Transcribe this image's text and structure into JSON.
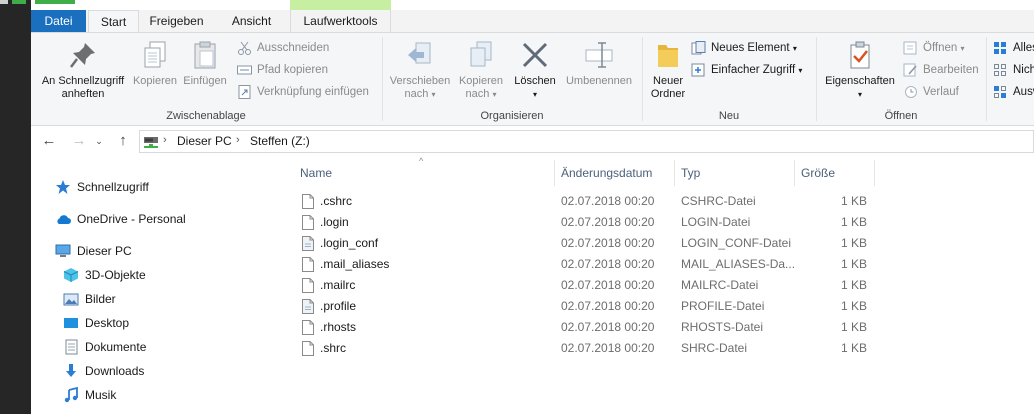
{
  "ribbon_tabs": {
    "file": "Datei",
    "start": "Start",
    "share": "Freigeben",
    "view": "Ansicht",
    "drive_tools": "Laufwerktools"
  },
  "clipboard": {
    "group_label": "Zwischenablage",
    "pin": "An Schnellzugriff anheften",
    "copy": "Kopieren",
    "paste": "Einfügen",
    "cut": "Ausschneiden",
    "copy_path": "Pfad kopieren",
    "paste_shortcut": "Verknüpfung einfügen"
  },
  "organize": {
    "group_label": "Organisieren",
    "move_to_1": "Verschieben",
    "move_to_2": "nach",
    "copy_to_1": "Kopieren",
    "copy_to_2": "nach",
    "delete": "Löschen",
    "rename": "Umbenennen"
  },
  "new": {
    "group_label": "Neu",
    "new_folder_1": "Neuer",
    "new_folder_2": "Ordner",
    "new_item": "Neues Element",
    "easy_access": "Einfacher Zugriff"
  },
  "open": {
    "group_label": "Öffnen",
    "properties": "Eigenschaften",
    "open": "Öffnen",
    "edit": "Bearbeiten",
    "history": "Verlauf"
  },
  "select": {
    "select_all": "Alles",
    "select_none": "Nich",
    "invert": "Ausw"
  },
  "address": {
    "crumbs": [
      "Dieser PC",
      "Steffen (Z:)"
    ]
  },
  "nav": {
    "quick_access": "Schnellzugriff",
    "onedrive": "OneDrive - Personal",
    "this_pc": "Dieser PC",
    "objects3d": "3D-Objekte",
    "pictures": "Bilder",
    "desktop": "Desktop",
    "documents": "Dokumente",
    "downloads": "Downloads",
    "music": "Musik"
  },
  "columns": {
    "name": "Name",
    "date": "Änderungsdatum",
    "type": "Typ",
    "size": "Größe"
  },
  "files": [
    {
      "name": ".cshrc",
      "date": "02.07.2018 00:20",
      "type": "CSHRC-Datei",
      "size": "1 KB",
      "icon": "blank-file-icon"
    },
    {
      "name": ".login",
      "date": "02.07.2018 00:20",
      "type": "LOGIN-Datei",
      "size": "1 KB",
      "icon": "blank-file-icon"
    },
    {
      "name": ".login_conf",
      "date": "02.07.2018 00:20",
      "type": "LOGIN_CONF-Datei",
      "size": "1 KB",
      "icon": "config-file-icon"
    },
    {
      "name": ".mail_aliases",
      "date": "02.07.2018 00:20",
      "type": "MAIL_ALIASES-Da...",
      "size": "1 KB",
      "icon": "blank-file-icon"
    },
    {
      "name": ".mailrc",
      "date": "02.07.2018 00:20",
      "type": "MAILRC-Datei",
      "size": "1 KB",
      "icon": "blank-file-icon"
    },
    {
      "name": ".profile",
      "date": "02.07.2018 00:20",
      "type": "PROFILE-Datei",
      "size": "1 KB",
      "icon": "config-file-icon"
    },
    {
      "name": ".rhosts",
      "date": "02.07.2018 00:20",
      "type": "RHOSTS-Datei",
      "size": "1 KB",
      "icon": "blank-file-icon"
    },
    {
      "name": ".shrc",
      "date": "02.07.2018 00:20",
      "type": "SHRC-Datei",
      "size": "1 KB",
      "icon": "blank-file-icon"
    }
  ],
  "colors": {
    "file_tab": "#1a6fbf",
    "context_tab": "#c6efa2",
    "column_header_text": "#4c607a",
    "folder_yellow": "#e8b53b",
    "accent_blue": "#2b7cd3"
  }
}
